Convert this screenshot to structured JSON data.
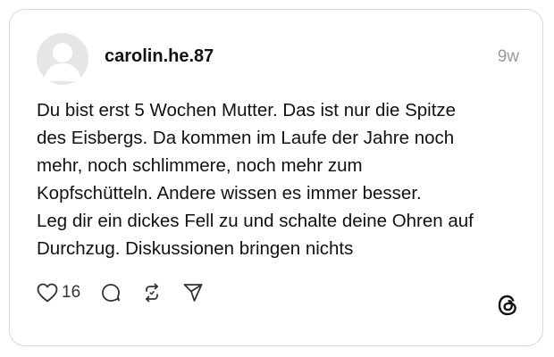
{
  "post": {
    "username": "carolin.he.87",
    "timestamp": "9w",
    "text_lines": [
      "Du bist erst 5 Wochen Mutter. Das ist nur die Spitze",
      "des Eisbergs. Da kommen im Laufe der Jahre noch",
      "mehr, noch schlimmere, noch mehr zum",
      "Kopfschütteln. Andere wissen es immer besser.",
      "Leg dir ein dickes Fell zu und schalte deine Ohren auf",
      "Durchzug. Diskussionen bringen nichts"
    ],
    "like_count": "16"
  },
  "icons": {
    "avatar": "default-avatar-icon",
    "like": "heart-icon",
    "reply": "comment-icon",
    "repost": "repost-icon",
    "share": "send-icon",
    "brand": "threads-logo-icon"
  },
  "colors": {
    "border": "#d9d9d9",
    "avatar_bg": "#e6e6e6",
    "avatar_fg": "#ffffff",
    "timestamp": "#999999",
    "text": "#111111"
  }
}
